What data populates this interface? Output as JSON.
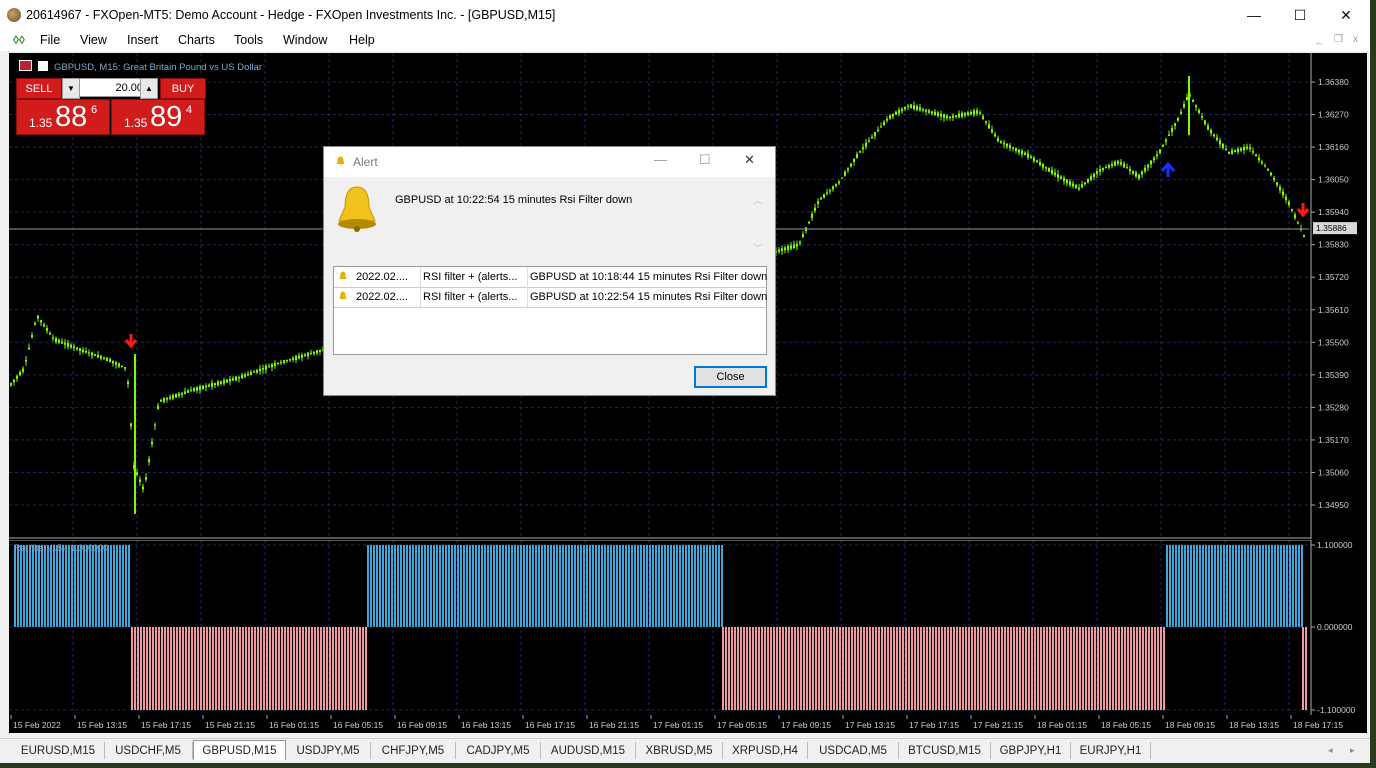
{
  "window": {
    "title": "20614967 - FXOpen-MT5: Demo Account - Hedge - FXOpen Investments Inc. - [GBPUSD,M15]",
    "minimize": "—",
    "maximize": "☐",
    "close": "✕"
  },
  "menu": {
    "items": [
      "File",
      "View",
      "Insert",
      "Charts",
      "Tools",
      "Window",
      "Help"
    ],
    "mdi_minimize": "_",
    "mdi_restore": "❐",
    "mdi_close": "x"
  },
  "chart": {
    "title": "GBPUSD, M15:  Great Britain Pound vs US Dollar",
    "indicator_label": "Rsi filter (15) -1.000000",
    "current_price": "1.35886",
    "price_labels": [
      "1.36380",
      "1.36270",
      "1.36160",
      "1.36050",
      "1.35940",
      "1.35830",
      "1.35720",
      "1.35610",
      "1.35500",
      "1.35390",
      "1.35280",
      "1.35170",
      "1.35060",
      "1.34950"
    ],
    "indicator_scale": [
      "1.100000",
      "0.000000",
      "-1.100000"
    ],
    "time_labels": [
      "15 Feb 2022",
      "15 Feb 13:15",
      "15 Feb 17:15",
      "15 Feb 21:15",
      "16 Feb 01:15",
      "16 Feb 05:15",
      "16 Feb 09:15",
      "16 Feb 13:15",
      "16 Feb 17:15",
      "16 Feb 21:15",
      "17 Feb 01:15",
      "17 Feb 05:15",
      "17 Feb 09:15",
      "17 Feb 13:15",
      "17 Feb 17:15",
      "17 Feb 21:15",
      "18 Feb 01:15",
      "18 Feb 05:15",
      "18 Feb 09:15",
      "18 Feb 13:15",
      "18 Feb 17:15"
    ],
    "colors": {
      "background": "#000000",
      "grid": "#1a2a6a",
      "candles": "#7cfc00",
      "indicator_up": "#3fa7dc",
      "indicator_down": "#f09aa0",
      "sell_arrow": "#ff1a1a",
      "buy_arrow": "#1530ff"
    }
  },
  "trade_panel": {
    "sell_label": "SELL",
    "buy_label": "BUY",
    "lot_value": "20.00",
    "lot_down": "▼",
    "lot_up": "▲",
    "sell_price_prefix": "1.35",
    "sell_price_big": "88",
    "sell_price_sup": "6",
    "buy_price_prefix": "1.35",
    "buy_price_big": "89",
    "buy_price_sup": "4"
  },
  "alert": {
    "title": "Alert",
    "minimize": "—",
    "maximize": "☐",
    "close": "✕",
    "message": "GBPUSD at 10:22:54 15 minutes Rsi Filter  down",
    "scroll_up": "︿",
    "scroll_down": "﹀",
    "rows": [
      {
        "time": "2022.02....",
        "source": "RSI filter + (alerts...",
        "message": "GBPUSD at 10:18:44 15 minutes Rsi Filter  down"
      },
      {
        "time": "2022.02....",
        "source": "RSI filter + (alerts...",
        "message": "GBPUSD at 10:22:54 15 minutes Rsi Filter  down"
      }
    ],
    "close_button": "Close"
  },
  "tabs": {
    "items": [
      "EURUSD,M15",
      "USDCHF,M5",
      "GBPUSD,M15",
      "USDJPY,M5",
      "CHFJPY,M5",
      "CADJPY,M5",
      "AUDUSD,M15",
      "XBRUSD,M5",
      "XRPUSD,H4",
      "USDCAD,M5",
      "BTCUSD,M15",
      "GBPJPY,H1",
      "EURJPY,H1"
    ],
    "active": "GBPUSD,M15",
    "scroll_left": "◂",
    "scroll_right": "▸"
  }
}
